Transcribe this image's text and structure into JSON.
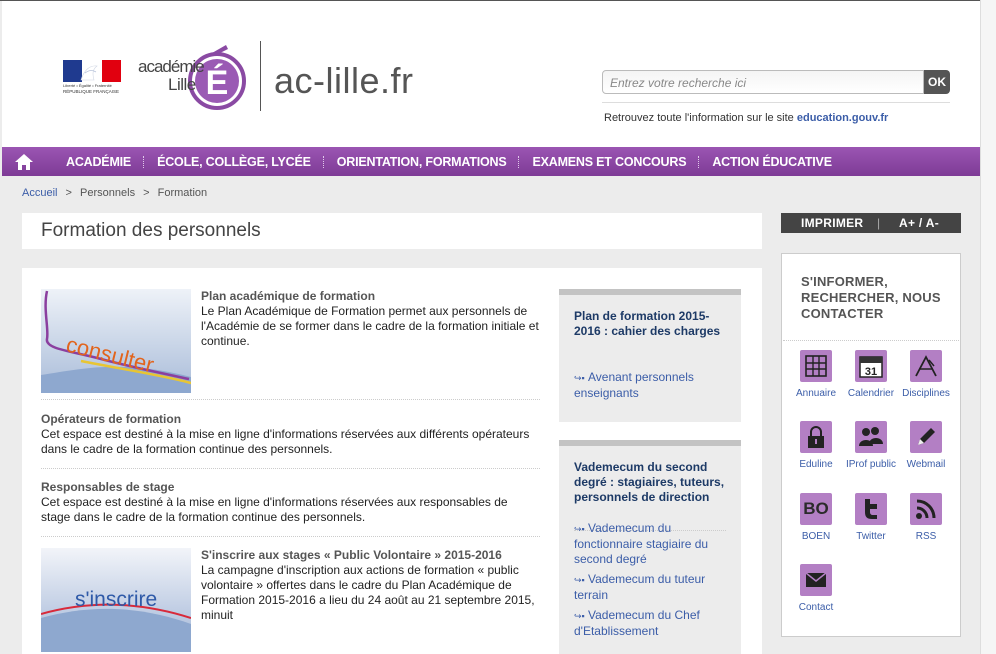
{
  "header": {
    "rf_line1": "Liberté • Égalité • Fraternité",
    "rf_line2": "RÉPUBLIQUE FRANÇAISE",
    "academie_word": "académie",
    "lille_word": "Lille",
    "logo_letter": "É",
    "site_name": "ac-lille.fr",
    "search_placeholder": "Entrez votre recherche ici",
    "search_button": "OK",
    "retrouvez_text": "Retrouvez toute l'information sur le site ",
    "retrouvez_link": "education.gouv.fr"
  },
  "nav": {
    "items": [
      "ACADÉMIE",
      "ÉCOLE, COLLÈGE, LYCÉE",
      "ORIENTATION, FORMATIONS",
      "EXAMENS ET CONCOURS",
      "ACTION ÉDUCATIVE"
    ]
  },
  "breadcrumb": {
    "items": [
      "Accueil",
      "Personnels",
      "Formation"
    ],
    "separator": ">"
  },
  "page_title": "Formation des personnels",
  "content": {
    "items": [
      {
        "thumb_word": "consulter",
        "title": "Plan académique de formation",
        "text": "Le Plan Académique de Formation permet aux personnels de l'Académie de se former dans le cadre de la formation initiale et continue."
      },
      {
        "title": "Opérateurs de formation",
        "text": "Cet espace est destiné à la mise en ligne d'informations réservées aux différents opérateurs dans le cadre de la formation continue des personnels."
      },
      {
        "title": "Responsables de stage",
        "text": "Cet espace est destiné à la mise en ligne d'informations réservées aux responsables de stage dans le cadre de la formation continue des personnels."
      },
      {
        "thumb_word": "s'inscrire",
        "title": "S'inscrire aux stages « Public Volontaire » 2015-2016",
        "text": "La campagne d'inscription aux actions de formation « public volontaire » offertes dans le cadre du Plan Académique de Formation 2015-2016 a lieu du 24 août au 21 septembre 2015, minuit"
      }
    ]
  },
  "side_boxes": [
    {
      "title": "Plan de formation 2015-2016 : cahier des charges",
      "links": [
        "Avenant personnels enseignants"
      ]
    },
    {
      "title": "Vademecum du second degré : stagiaires, tuteurs, personnels de direction",
      "links": [
        "Vademecum du fonctionnaire stagiaire du second degré",
        "Vademecum du tuteur terrain",
        "Vademecum du Chef d'Etablissement"
      ]
    }
  ],
  "tools": {
    "print": "IMPRIMER",
    "bar": "|",
    "size": "A+ / A-"
  },
  "sidebar": {
    "title": "S'INFORMER, RECHERCHER, NOUS CONTACTER",
    "calendar_day": "31",
    "boen_text": "BO",
    "tiles": [
      "Annuaire",
      "Calendrier",
      "Disciplines",
      "Eduline",
      "IProf public",
      "Webmail",
      "BOEN",
      "Twitter",
      "RSS",
      "Contact"
    ]
  },
  "colors": {
    "nav_purple": "#8a45a3",
    "tile_purple": "#b37fc4",
    "link_blue": "#3b5da8",
    "title_navy": "#1d3a66"
  }
}
